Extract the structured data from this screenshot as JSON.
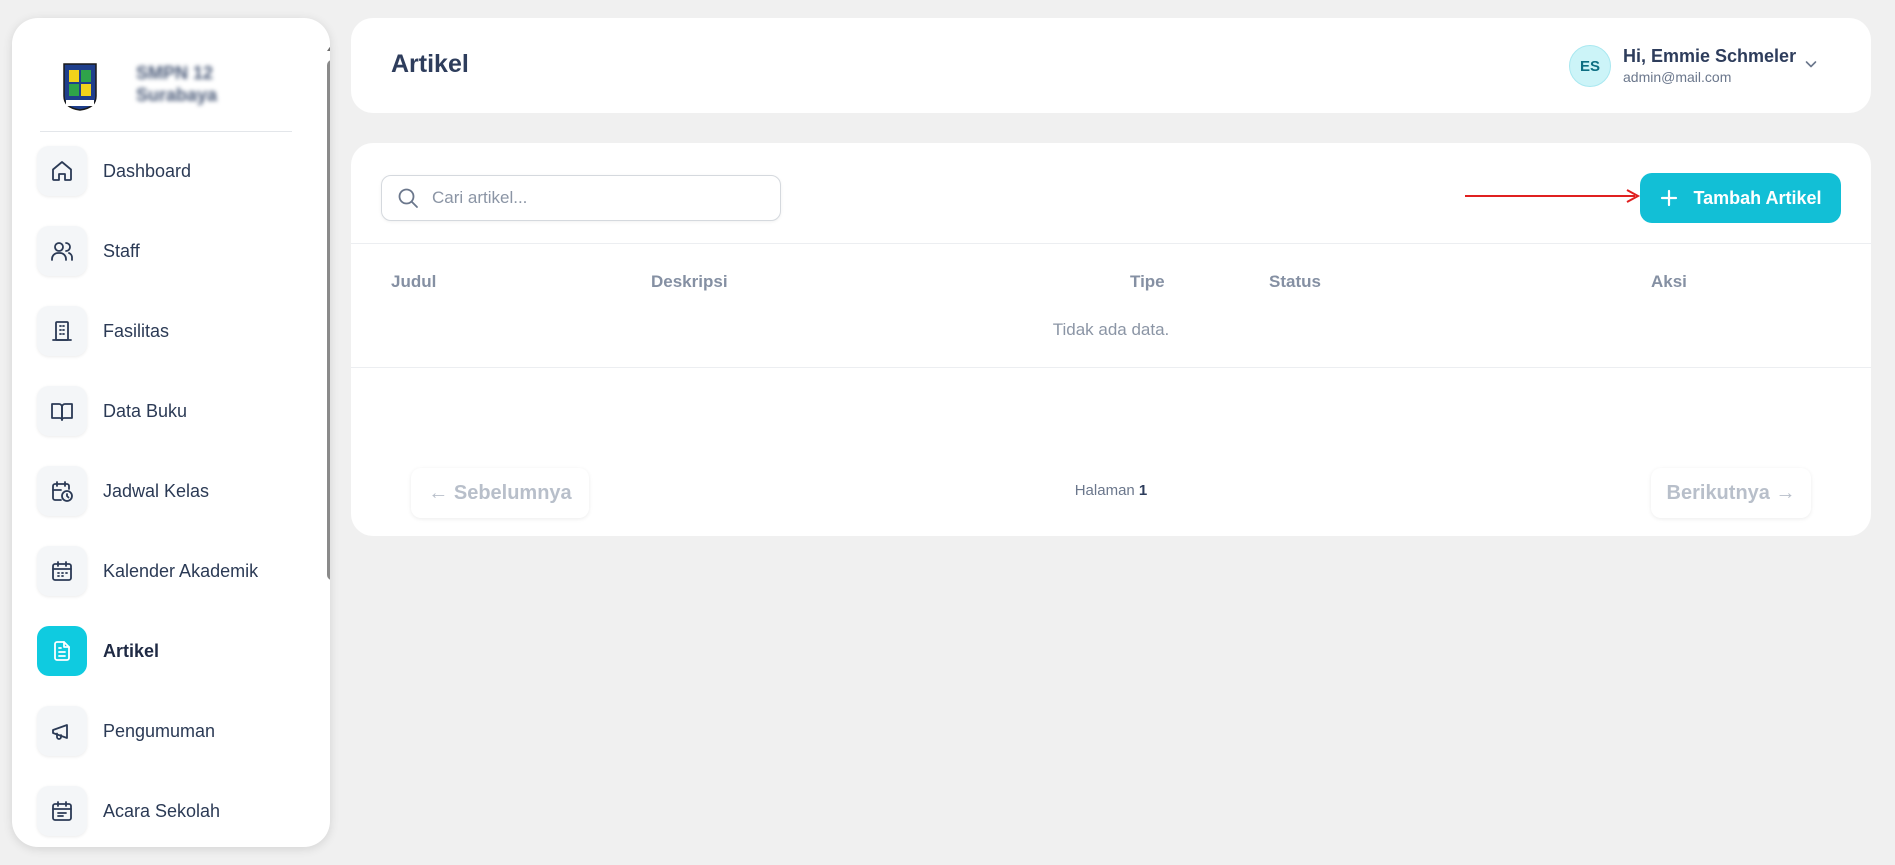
{
  "sidebar": {
    "brand_line1": "SMPN 12",
    "brand_line2": "Surabaya",
    "items": [
      {
        "label": "Dashboard",
        "icon": "home-icon"
      },
      {
        "label": "Staff",
        "icon": "users-icon"
      },
      {
        "label": "Fasilitas",
        "icon": "building-icon"
      },
      {
        "label": "Data Buku",
        "icon": "book-open-icon"
      },
      {
        "label": "Jadwal Kelas",
        "icon": "calendar-clock-icon"
      },
      {
        "label": "Kalender Akademik",
        "icon": "calendar-icon"
      },
      {
        "label": "Artikel",
        "icon": "document-icon",
        "active": true
      },
      {
        "label": "Pengumuman",
        "icon": "megaphone-icon"
      },
      {
        "label": "Acara Sekolah",
        "icon": "calendar-event-icon"
      }
    ]
  },
  "header": {
    "title": "Artikel",
    "user": {
      "initials": "ES",
      "greeting": "Hi, Emmie Schmeler",
      "email": "admin@mail.com"
    }
  },
  "toolbar": {
    "search_placeholder": "Cari artikel...",
    "add_label": "Tambah Artikel"
  },
  "table": {
    "columns": [
      "Judul",
      "Deskripsi",
      "Tipe",
      "Status",
      "Aksi"
    ],
    "empty_text": "Tidak ada data."
  },
  "pagination": {
    "prev_label": "← Sebelumnya",
    "next_label": "Berikutnya →",
    "page_label": "Halaman",
    "page_number": "1"
  },
  "colors": {
    "accent": "#12bfd6",
    "active_nav": "#0fcbe0",
    "annotation": "#e02020"
  }
}
